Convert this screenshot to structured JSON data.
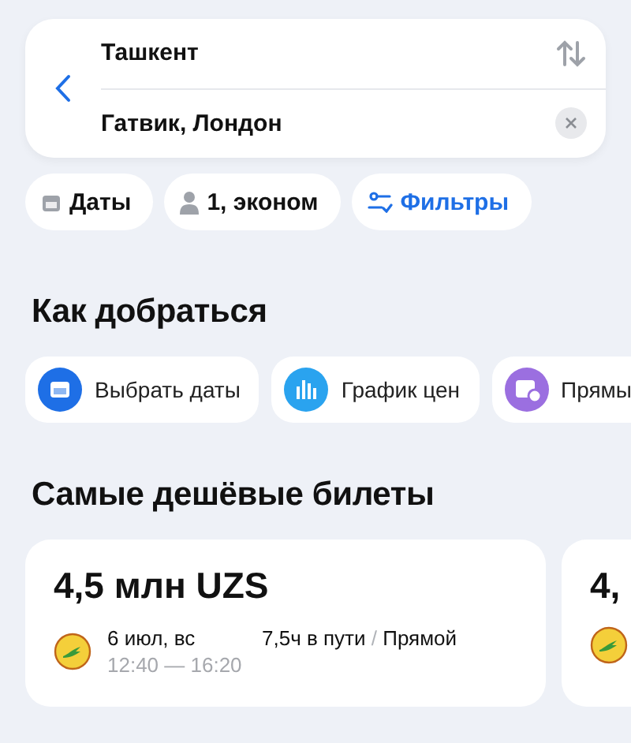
{
  "route": {
    "origin": "Ташкент",
    "destination": "Гатвик, Лондон"
  },
  "filters": [
    {
      "kind": "dates",
      "label": "Даты"
    },
    {
      "kind": "passengers",
      "label": "1, эконом"
    },
    {
      "kind": "filters",
      "label": "Фильтры"
    }
  ],
  "how_to_get": {
    "title": "Как добраться",
    "actions": [
      {
        "kind": "calendar",
        "label": "Выбрать даты",
        "color": "#1e6fe6"
      },
      {
        "kind": "chart",
        "label": "График цен",
        "color": "#2aa3ef"
      },
      {
        "kind": "direct",
        "label": "Прямы",
        "color": "#9b6fe0"
      }
    ]
  },
  "cheapest": {
    "title": "Самые дешёвые билеты",
    "tickets": [
      {
        "price": "4,5 млн UZS",
        "date": "6 июл, вс",
        "time": "12:40 — 16:20",
        "duration": "7,5ч в пути",
        "separator": "/",
        "stops": "Прямой"
      },
      {
        "price": "4,"
      }
    ]
  }
}
